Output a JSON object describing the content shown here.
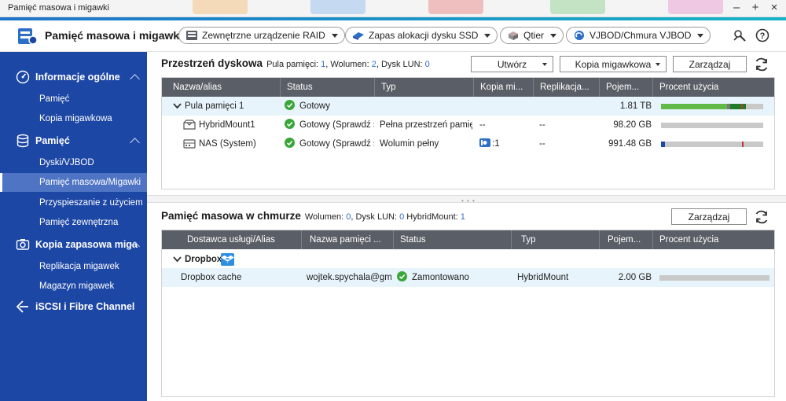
{
  "window": {
    "title": "Pamięć masowa i migawki"
  },
  "header": {
    "app_title": "Pamięć masowa i migawki",
    "buttons": [
      {
        "label": "Zewnętrzne urządzenie RAID",
        "icon": "raid-device-icon"
      },
      {
        "label": "Zapas alokacji dysku SSD",
        "icon": "ssd-overprovision-icon"
      },
      {
        "label": "Qtier",
        "icon": "qtier-icon"
      },
      {
        "label": "VJBOD/Chmura VJBOD",
        "icon": "vjbod-icon"
      }
    ]
  },
  "sidebar": {
    "groups": [
      {
        "label": "Informacje ogólne",
        "icon": "dashboard-icon",
        "items": [
          "Pamięć",
          "Kopia migawkowa"
        ]
      },
      {
        "label": "Pamięć",
        "icon": "database-icon",
        "items": [
          "Dyski/VJBOD",
          "Pamięć masowa/Migawki",
          "Przyspieszanie z użyciem",
          "Pamięć zewnętrzna"
        ]
      },
      {
        "label": "Kopia zapasowa miga",
        "icon": "snapshot-backup-icon",
        "items": [
          "Replikacja migawek",
          "Magazyn migawek"
        ]
      },
      {
        "label": "iSCSI i Fibre Channel",
        "icon": "iscsi-icon",
        "items": []
      }
    ],
    "active_item": "Pamięć masowa/Migawki"
  },
  "disk_space": {
    "title": "Przestrzeń dyskowa",
    "info_pool_label": "Pula pamięci:",
    "info_pool_value": "1",
    "info_volume_label": ", Wolumen:",
    "info_volume_value": "2",
    "info_lun_label": ", Dysk LUN:",
    "info_lun_value": "0",
    "create_button": "Utwórz",
    "snapshot_button": "Kopia migawkowa",
    "manage_button": "Zarządzaj",
    "columns": [
      "Nazwa/alias",
      "Status",
      "Typ",
      "Kopia mi...",
      "Replikacja...",
      "Pojem...",
      "Procent użycia"
    ],
    "rows": [
      {
        "name": "Pula pamięci 1",
        "status": "Gotowy",
        "type": "",
        "snapshot": "",
        "replication": "",
        "capacity": "1.81 TB",
        "usage": 0.8,
        "kind": "pool"
      },
      {
        "name": "HybridMount1",
        "status": "Gotowy (Sprawdź s",
        "type": "Pełna przestrzeń pamięć",
        "snapshot": "--",
        "replication": "--",
        "capacity": "98.20 GB",
        "usage": 0.0,
        "kind": "hybrid"
      },
      {
        "name": "NAS (System)",
        "status": "Gotowy (Sprawdź s",
        "type": "Wolumin pełny",
        "snapshot": ":1",
        "replication": "--",
        "capacity": "991.48 GB",
        "usage": 0.04,
        "kind": "nas"
      }
    ]
  },
  "cloud": {
    "title": "Pamięć masowa w chmurze",
    "info_volume_label": "Wolumen:",
    "info_volume_value": "0",
    "info_lun_label": ", Dysk LUN:",
    "info_lun_value": "0",
    "info_hybrid_label": "HybridMount:",
    "info_hybrid_value": "1",
    "manage_button": "Zarządzaj",
    "columns": [
      "Dostawca usługi/Alias",
      "Nazwa pamięci ...",
      "Status",
      "Typ",
      "Pojem...",
      "Procent użycia"
    ],
    "group": "Dropbox",
    "rows": [
      {
        "alias": "Dropbox cache",
        "storage": "wojtek.spychala@gm",
        "status": "Zamontowano",
        "type": "HybridMount",
        "capacity": "2.00 GB",
        "usage": 0.0
      }
    ]
  },
  "colors": {
    "sidebar": "#1d47a5",
    "sidebar_active": "#4f74c4",
    "accent": "#2d6ec7",
    "ok_green": "#3aa63a",
    "table_header": "#5a5e66",
    "row_highlight": "#e7f4fb"
  }
}
